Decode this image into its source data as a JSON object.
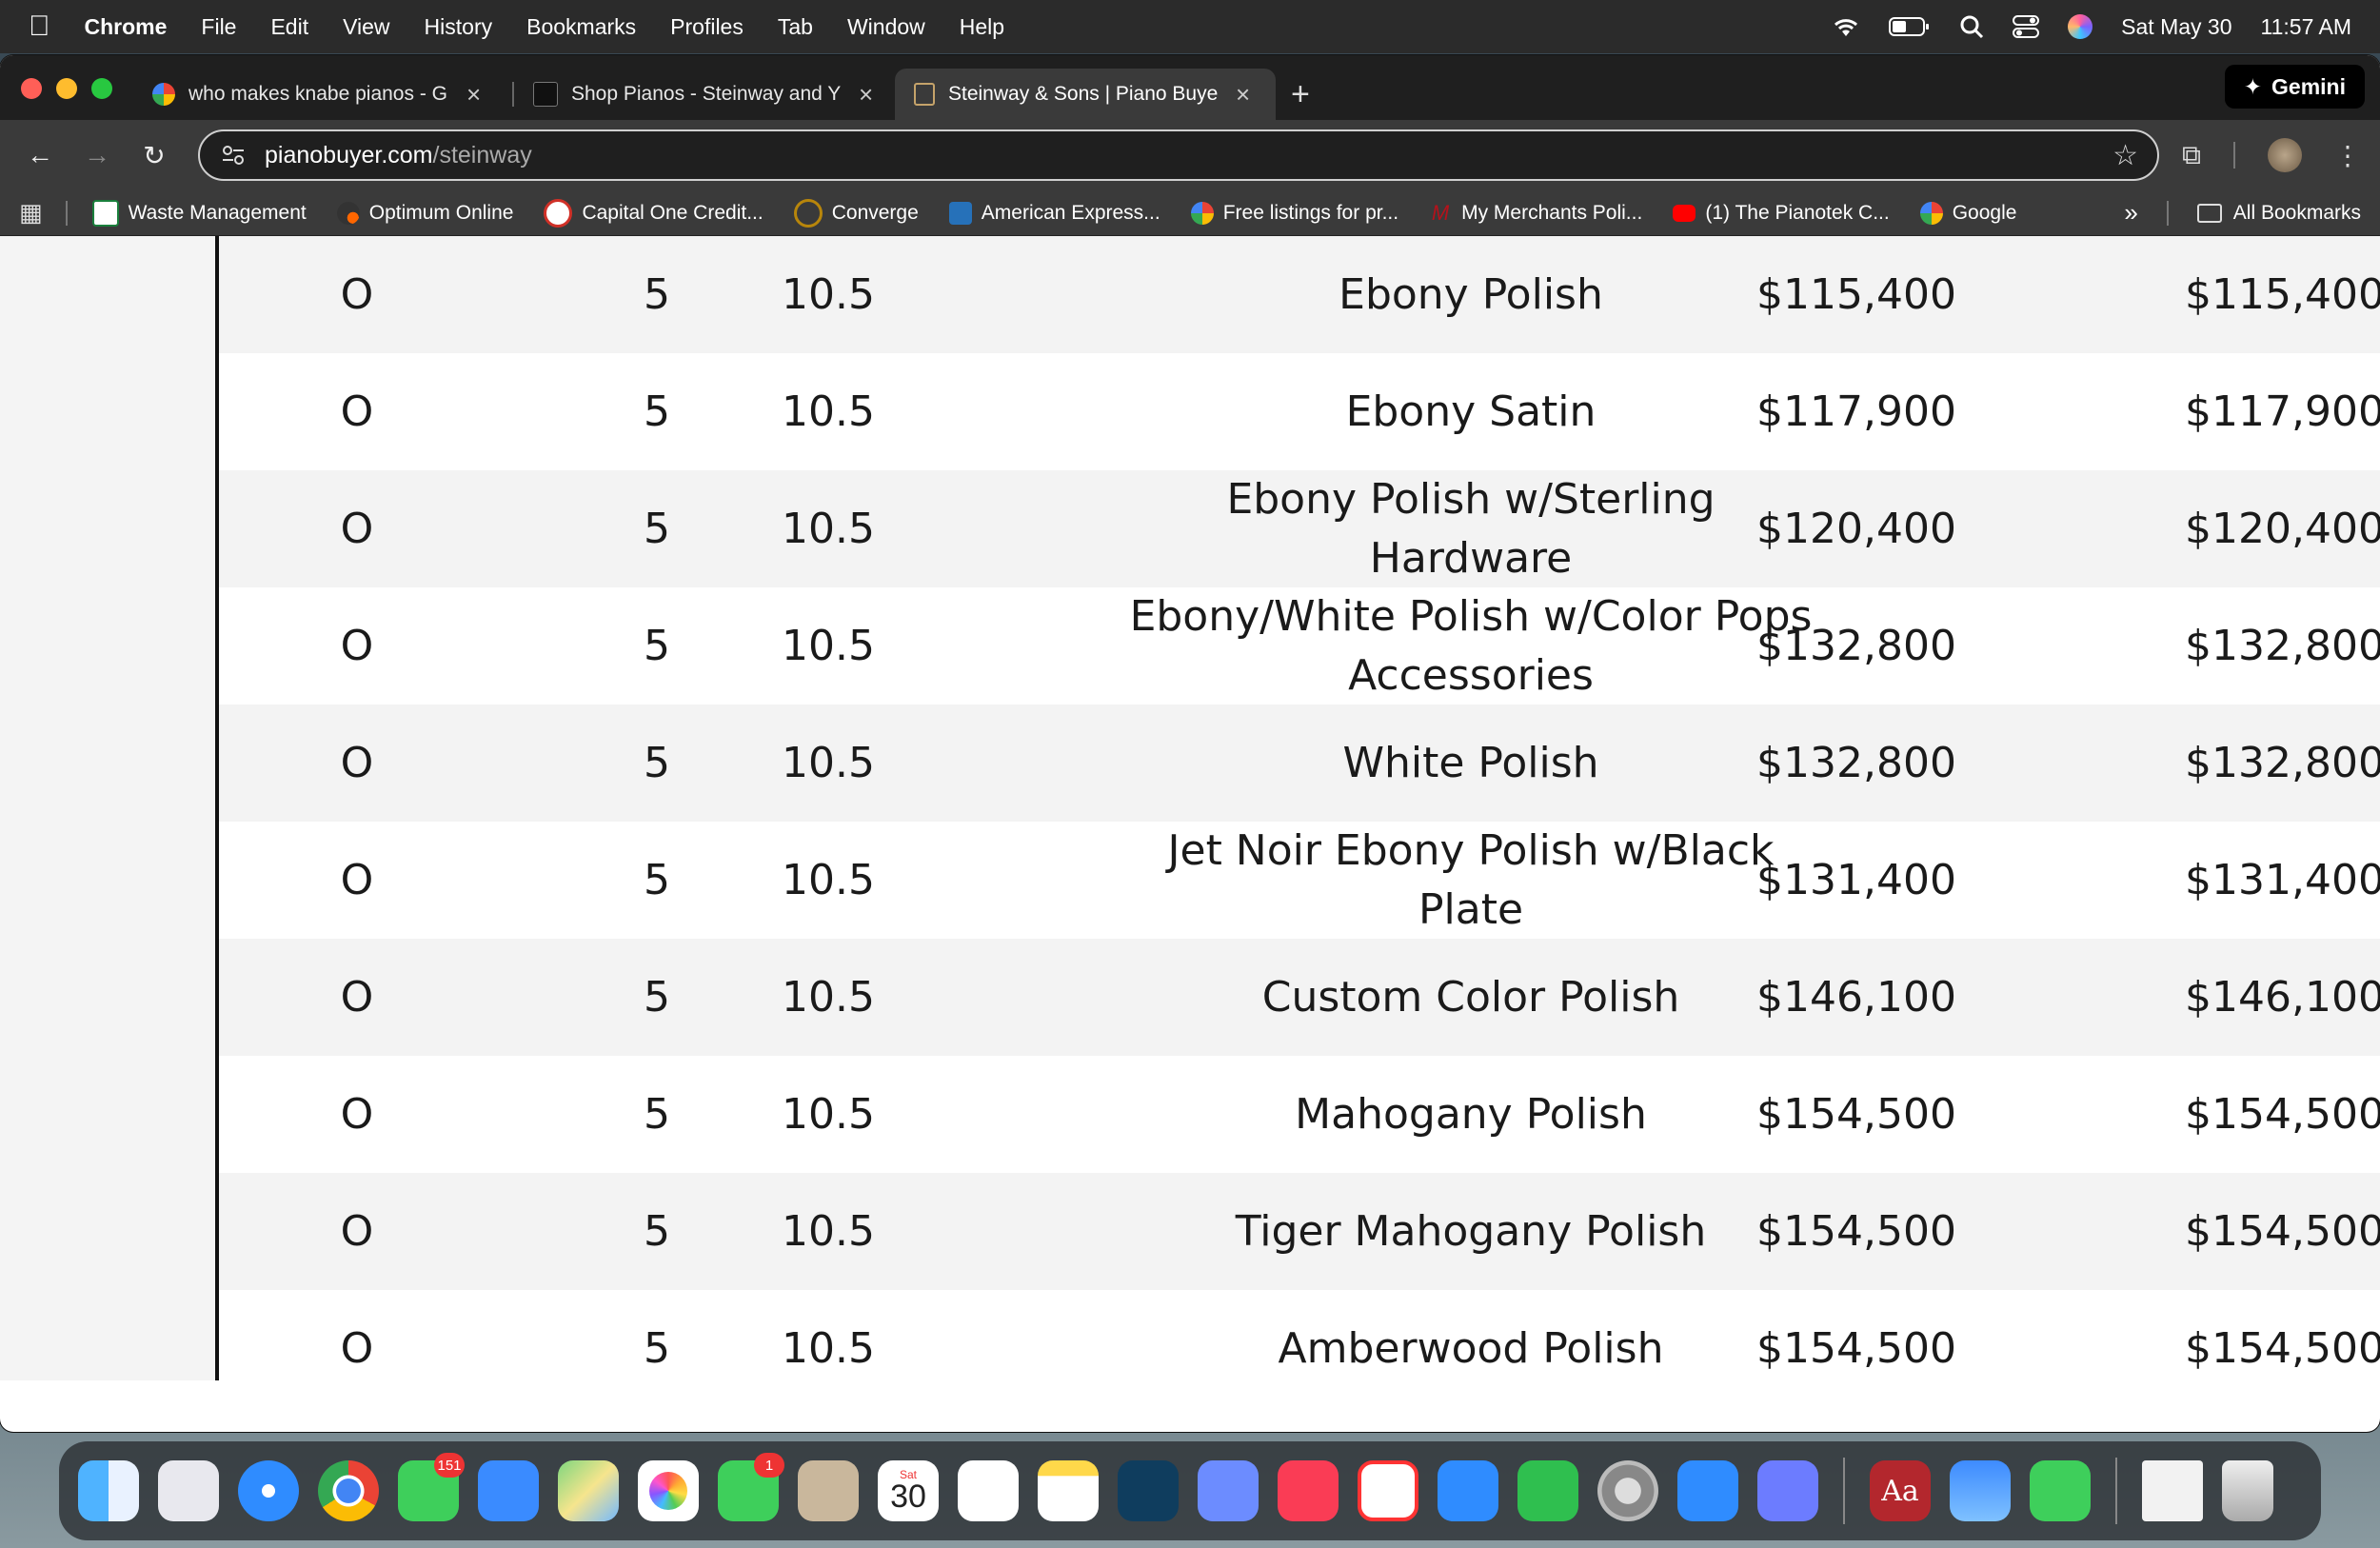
{
  "menubar": {
    "app": "Chrome",
    "items": [
      "File",
      "Edit",
      "View",
      "History",
      "Bookmarks",
      "Profiles",
      "Tab",
      "Window",
      "Help"
    ],
    "date": "Sat May 30",
    "time": "11:57 AM"
  },
  "tabs": [
    {
      "label": "who makes knabe pianos - G",
      "favicon_color": "#4285f4"
    },
    {
      "label": "Shop Pianos - Steinway and Y",
      "favicon_color": "#111111"
    },
    {
      "label": "Steinway & Sons | Piano Buye",
      "favicon_color": "#c5a36a"
    }
  ],
  "gemini_label": "Gemini",
  "url": {
    "domain": "pianobuyer.com",
    "path": "/steinway"
  },
  "bookmarks": [
    {
      "label": "Waste Management",
      "color": "#1a7f3c"
    },
    {
      "label": "Optimum Online",
      "color": "#333333"
    },
    {
      "label": "Capital One Credit...",
      "color": "#d03027"
    },
    {
      "label": "Converge",
      "color": "#b8860b"
    },
    {
      "label": "American Express...",
      "color": "#2671b9"
    },
    {
      "label": "Free listings for pr...",
      "color": "#4285f4"
    },
    {
      "label": "My Merchants Poli...",
      "color": "#b5121b"
    },
    {
      "label": "(1) The Pianotek C...",
      "color": "#ff0000"
    },
    {
      "label": "Google",
      "color": "#4285f4"
    }
  ],
  "all_bookmarks_label": "All Bookmarks",
  "rows": [
    {
      "c1": "O",
      "c2": "5",
      "c3": "10.5",
      "finish": "Ebony Polish",
      "price1": "$115,400",
      "price2": "$115,400"
    },
    {
      "c1": "O",
      "c2": "5",
      "c3": "10.5",
      "finish": "Ebony Satin",
      "price1": "$117,900",
      "price2": "$117,900"
    },
    {
      "c1": "O",
      "c2": "5",
      "c3": "10.5",
      "finish": "Ebony Polish w/Sterling Hardware",
      "price1": "$120,400",
      "price2": "$120,400"
    },
    {
      "c1": "O",
      "c2": "5",
      "c3": "10.5",
      "finish": "Ebony/White Polish w/Color Pops Accessories",
      "price1": "$132,800",
      "price2": "$132,800"
    },
    {
      "c1": "O",
      "c2": "5",
      "c3": "10.5",
      "finish": "White Polish",
      "price1": "$132,800",
      "price2": "$132,800"
    },
    {
      "c1": "O",
      "c2": "5",
      "c3": "10.5",
      "finish": "Jet Noir Ebony Polish w/Black Plate",
      "price1": "$131,400",
      "price2": "$131,400"
    },
    {
      "c1": "O",
      "c2": "5",
      "c3": "10.5",
      "finish": "Custom Color Polish",
      "price1": "$146,100",
      "price2": "$146,100"
    },
    {
      "c1": "O",
      "c2": "5",
      "c3": "10.5",
      "finish": "Mahogany Polish",
      "price1": "$154,500",
      "price2": "$154,500"
    },
    {
      "c1": "O",
      "c2": "5",
      "c3": "10.5",
      "finish": "Tiger Mahogany Polish",
      "price1": "$154,500",
      "price2": "$154,500"
    },
    {
      "c1": "O",
      "c2": "5",
      "c3": "10.5",
      "finish": "Amberwood Polish",
      "price1": "$154,500",
      "price2": "$154,500"
    }
  ],
  "dock": {
    "messages_badge": "151",
    "facetime_badge": "1",
    "calendar_day": "30",
    "calendar_weekday": "Sat",
    "dictionary_label": "Aa"
  }
}
